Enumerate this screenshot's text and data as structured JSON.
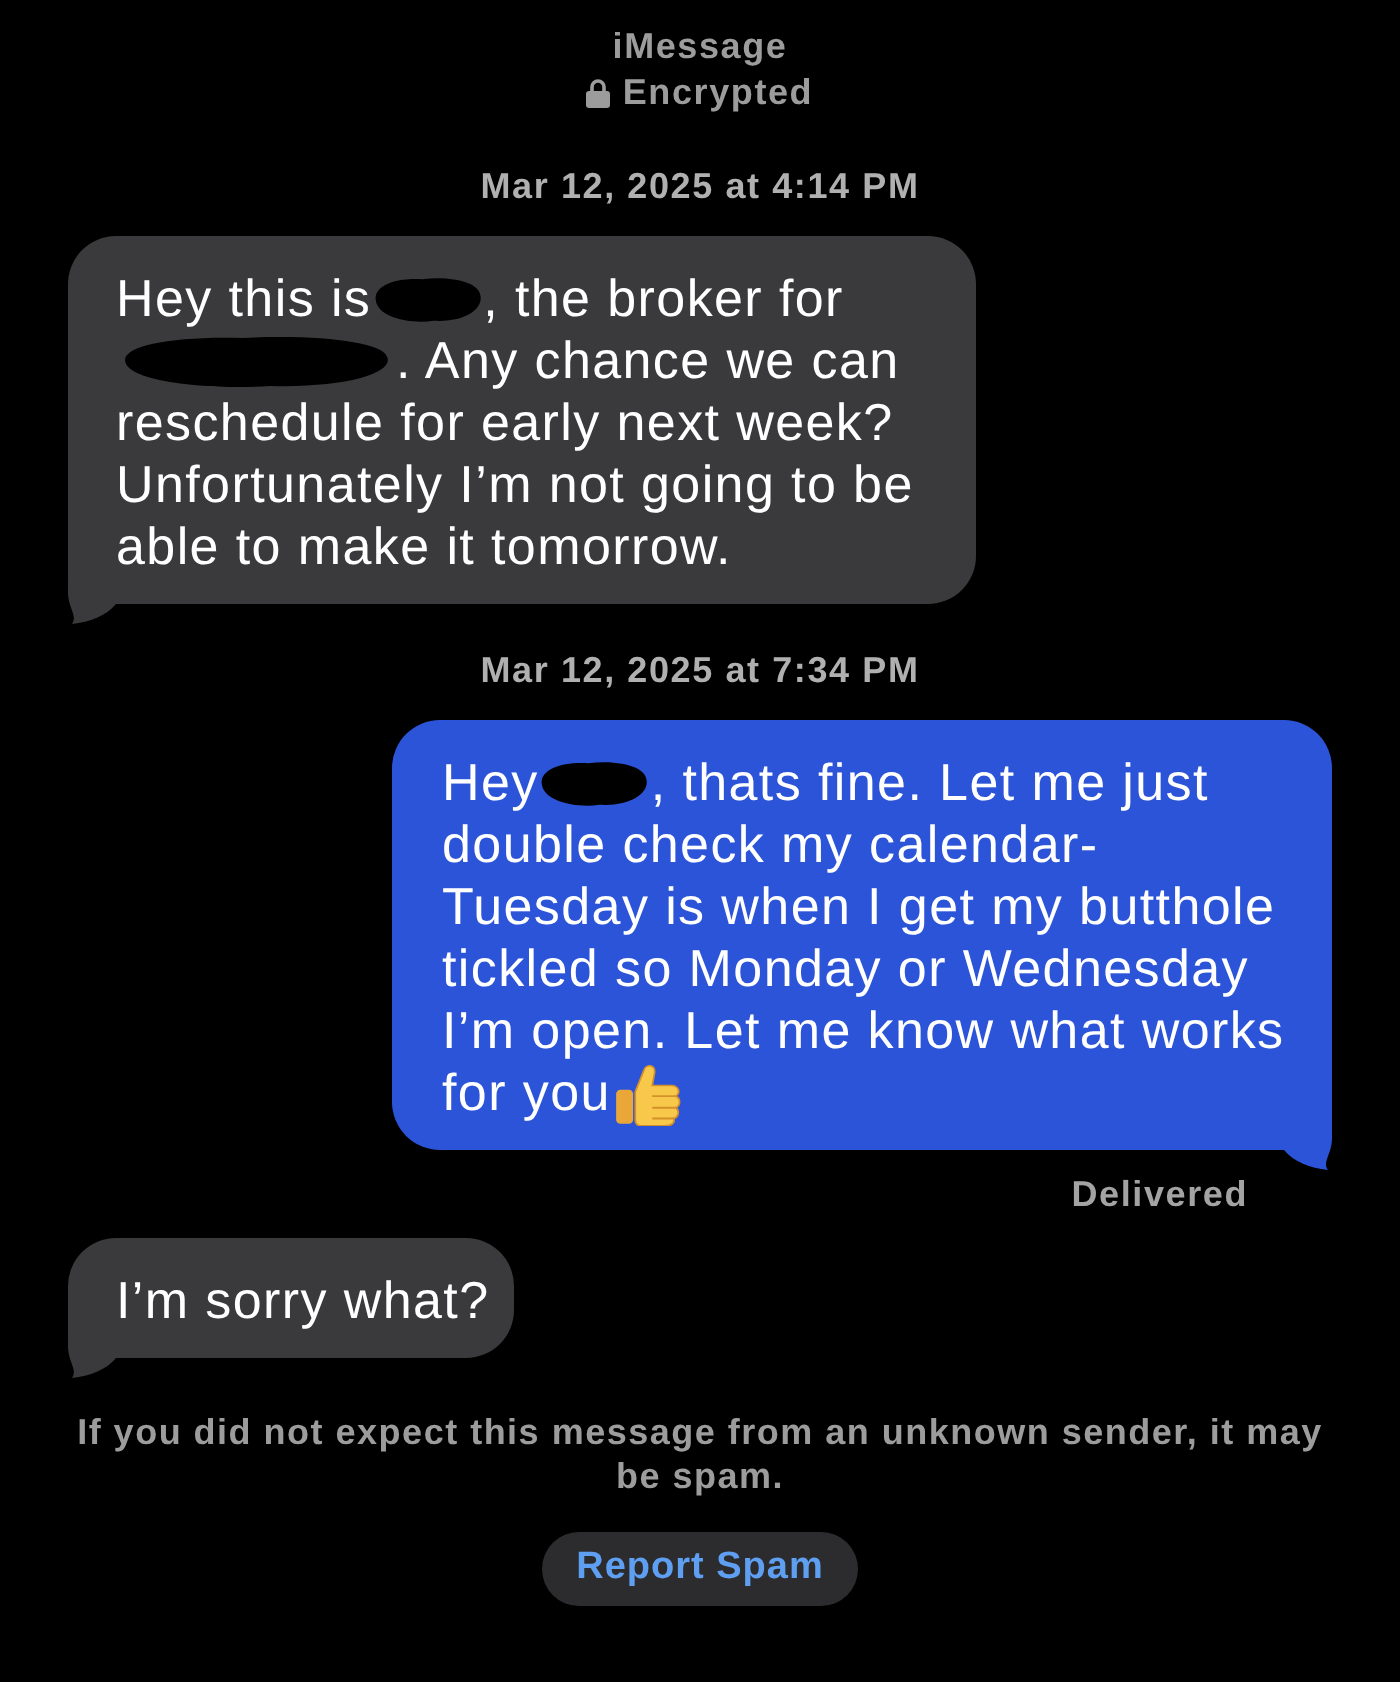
{
  "header": {
    "service": "iMessage",
    "security": "Encrypted"
  },
  "thread": [
    {
      "kind": "timestamp",
      "text": "Mar 12, 2025 at 4:14 PM"
    },
    {
      "kind": "incoming",
      "rows": [
        [
          {
            "kind": "text",
            "text": "Hey this is"
          },
          {
            "kind": "redaction"
          },
          {
            "kind": "text",
            "text": ", the broker for"
          }
        ],
        [
          {
            "kind": "redaction"
          },
          {
            "kind": "text",
            "text": ". Any chance we can"
          }
        ],
        [
          {
            "kind": "text",
            "text": "reschedule for early next week? Unfortunately I’m not going to be able to make it tomorrow."
          }
        ]
      ]
    },
    {
      "kind": "timestamp",
      "text": "Mar 12, 2025 at 7:34 PM"
    },
    {
      "kind": "outgoing",
      "rows": [
        [
          {
            "kind": "text",
            "text": "Hey"
          },
          {
            "kind": "redaction"
          },
          {
            "kind": "text",
            "text": ", thats fine. Let me just"
          }
        ],
        [
          {
            "kind": "text",
            "text": "double check my calendar- Tuesday is when I get my butthole tickled so Monday or Wednesday I’m open. Let me know what works"
          }
        ],
        [
          {
            "kind": "text",
            "text": "for you"
          },
          {
            "kind": "emoji"
          }
        ]
      ]
    },
    {
      "kind": "status",
      "text": "Delivered"
    },
    {
      "kind": "incoming",
      "rows": [
        [
          {
            "kind": "text",
            "text": "I’m sorry what?"
          }
        ]
      ]
    }
  ],
  "spam_notice": {
    "text": "If you did not expect this message from an unknown sender, it may be spam.",
    "button": "Report Spam"
  }
}
